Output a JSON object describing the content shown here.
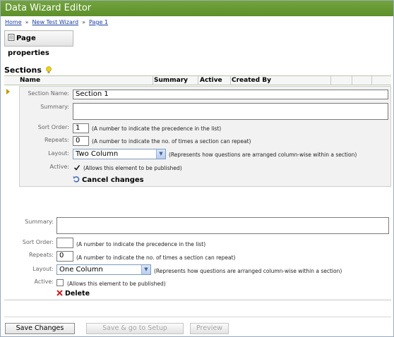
{
  "window": {
    "title": "Data Wizard Editor"
  },
  "breadcrumb": {
    "home": "Home",
    "wizard": "New Test Wizard",
    "page": "Page 1"
  },
  "toolbar": {
    "page_properties": "Page properties"
  },
  "sections": {
    "title": "Sections",
    "columns": [
      "Name",
      "Summary",
      "Active",
      "Created By"
    ]
  },
  "edit_section": {
    "section_name_label": "Section Name:",
    "section_name_value": "Section 1",
    "summary_label": "Summary:",
    "summary_value": "",
    "sort_order_label": "Sort Order:",
    "sort_order_value": "1",
    "sort_order_hint": "(A number to indicate the precedence in the list)",
    "repeats_label": "Repeats:",
    "repeats_value": "0",
    "repeats_hint": "(A number to indicate the no. of times a section can repeat)",
    "layout_label": "Layout:",
    "layout_value": "Two Column",
    "layout_hint": "(Represents how questions are arranged column-wise within a section)",
    "active_label": "Active:",
    "active_checked": true,
    "active_hint": "(Allows this element to be published)",
    "cancel_label": "Cancel changes"
  },
  "new_section": {
    "summary_label": "Summary:",
    "summary_value": "",
    "sort_order_label": "Sort Order:",
    "sort_order_value": "",
    "sort_order_hint": "(A number to indicate the precedence in the list)",
    "repeats_label": "Repeats:",
    "repeats_value": "0",
    "repeats_hint": "(A number to indicate the no. of times a section can repeat)",
    "layout_label": "Layout:",
    "layout_value": "One Column",
    "layout_hint": "(Represents how questions are arranged column-wise within a section)",
    "active_label": "Active:",
    "active_checked": false,
    "active_hint": "(Allows this element to be published)",
    "delete_label": "Delete"
  },
  "footer": {
    "save_changes": "Save Changes",
    "save_go_setup": "Save & go to Setup",
    "preview": "Preview"
  },
  "colors": {
    "titlebar": "#66992f",
    "link": "#1a3ea0",
    "delete_icon": "#cc2222",
    "marker": "#c09b00"
  }
}
